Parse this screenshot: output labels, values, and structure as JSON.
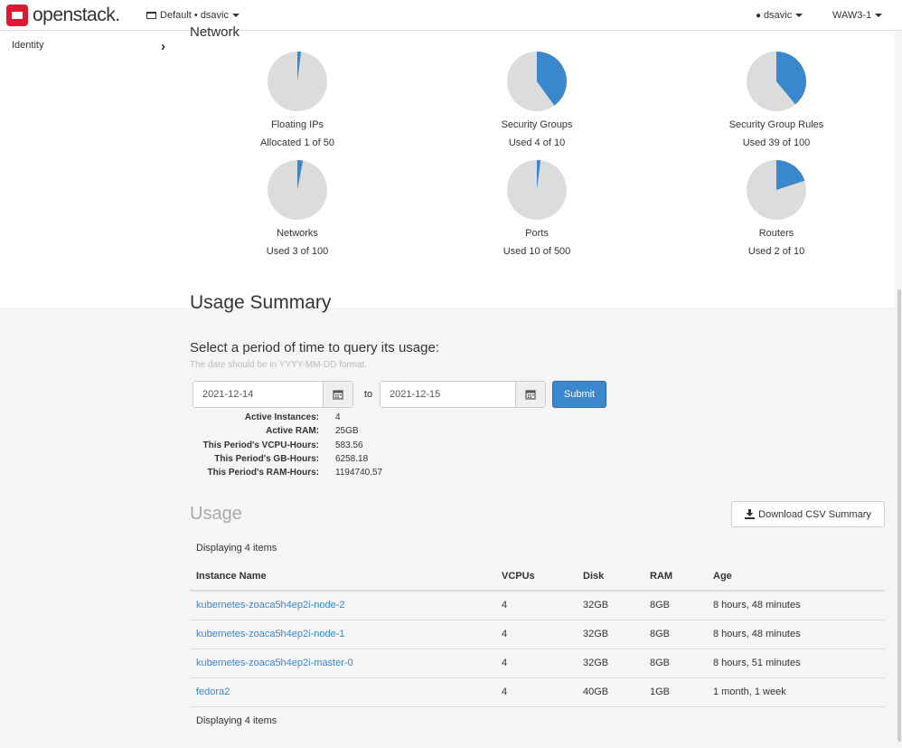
{
  "header": {
    "logo_text": "openstack.",
    "project": "Default • dsavic",
    "user": "dsavic",
    "region": "WAW3-1"
  },
  "sidebar": {
    "items": [
      {
        "label": "Identity"
      }
    ]
  },
  "network": {
    "title": "Network",
    "pies": [
      {
        "label": "Floating IPs",
        "sub": "Allocated 1 of 50",
        "used": 1,
        "total": 50
      },
      {
        "label": "Security Groups",
        "sub": "Used 4 of 10",
        "used": 4,
        "total": 10
      },
      {
        "label": "Security Group Rules",
        "sub": "Used 39 of 100",
        "used": 39,
        "total": 100
      },
      {
        "label": "Networks",
        "sub": "Used 3 of 100",
        "used": 3,
        "total": 100
      },
      {
        "label": "Ports",
        "sub": "Used 10 of 500",
        "used": 10,
        "total": 500
      },
      {
        "label": "Routers",
        "sub": "Used 2 of 10",
        "used": 2,
        "total": 10
      }
    ],
    "colors": {
      "used": "#3a87ce",
      "free": "#dcdcdc"
    }
  },
  "usage_summary": {
    "title": "Usage Summary",
    "period_title": "Select a period of time to query its usage:",
    "help": "The date should be in YYYY-MM-DD format.",
    "start": "2021-12-14",
    "to": "to",
    "end": "2021-12-15",
    "submit": "Submit",
    "stats": [
      {
        "k": "Active Instances:",
        "v": "4"
      },
      {
        "k": "Active RAM:",
        "v": "25GB"
      },
      {
        "k": "This Period's VCPU-Hours:",
        "v": "583.56"
      },
      {
        "k": "This Period's GB-Hours:",
        "v": "6258.18"
      },
      {
        "k": "This Period's RAM-Hours:",
        "v": "1194740.57"
      }
    ]
  },
  "usage": {
    "title": "Usage",
    "csv_button": "Download CSV Summary",
    "displaying": "Displaying 4 items",
    "columns": [
      "Instance Name",
      "VCPUs",
      "Disk",
      "RAM",
      "Age"
    ],
    "rows": [
      [
        "kubernetes-zoaca5h4ep2i-node-2",
        "4",
        "32GB",
        "8GB",
        "8 hours, 48 minutes"
      ],
      [
        "kubernetes-zoaca5h4ep2i-node-1",
        "4",
        "32GB",
        "8GB",
        "8 hours, 48 minutes"
      ],
      [
        "kubernetes-zoaca5h4ep2i-master-0",
        "4",
        "32GB",
        "8GB",
        "8 hours, 51 minutes"
      ],
      [
        "fedora2",
        "4",
        "40GB",
        "1GB",
        "1 month, 1 week"
      ]
    ]
  }
}
